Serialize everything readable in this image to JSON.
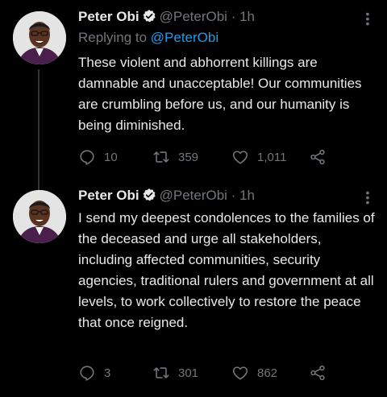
{
  "tweets": [
    {
      "author_name": "Peter Obi",
      "author_handle": "@PeterObi",
      "separator": "·",
      "time": "1h",
      "replying_prefix": "Replying to ",
      "replying_to": "@PeterObi",
      "text": "These violent and abhorrent killings are damnable and unacceptable! Our communities are crumbling before us, and our humanity is being diminished.",
      "replies": "10",
      "retweets": "359",
      "likes": "1,011"
    },
    {
      "author_name": "Peter Obi",
      "author_handle": "@PeterObi",
      "separator": "·",
      "time": "1h",
      "text": "I send my deepest condolences to the families of the deceased and urge all stakeholders, including affected communities, security agencies, traditional rulers and government at all levels, to work collectively to restore the peace that once reigned.",
      "replies": "3",
      "retweets": "301",
      "likes": "862"
    }
  ],
  "colors": {
    "background": "#000000",
    "text": "#e7e9ea",
    "muted": "#71767b",
    "link": "#1d9bf0",
    "verified_badge": "#e7e9ea",
    "thread_line": "#333639"
  },
  "icons": [
    "verified-icon",
    "more-icon",
    "reply-icon",
    "retweet-icon",
    "like-icon",
    "share-icon"
  ]
}
